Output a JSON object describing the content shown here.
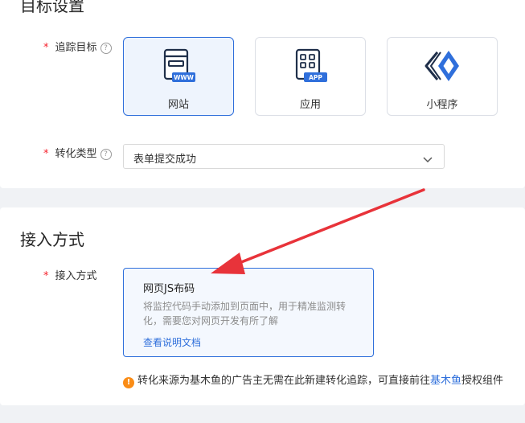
{
  "target_section": {
    "title": "目标设置",
    "track_label": "追踪目标",
    "tiles": [
      {
        "label": "网站",
        "badge": "WWW",
        "icon": "website-icon",
        "selected": true
      },
      {
        "label": "应用",
        "badge": "APP",
        "icon": "app-icon",
        "selected": false
      },
      {
        "label": "小程序",
        "icon": "mini-program-icon",
        "selected": false
      }
    ],
    "conversion_label": "转化类型",
    "conversion_value": "表单提交成功"
  },
  "access_section": {
    "title": "接入方式",
    "label": "接入方式",
    "method": {
      "title": "网页JS布码",
      "description": "将监控代码手动添加到页面中，用于精准监测转化，需要您对网页开发有所了解",
      "link": "查看说明文档"
    },
    "notice_prefix": "转化来源为基木鱼的广告主无需在此新建转化追踪，可直接前往",
    "notice_link": "基木鱼",
    "notice_suffix": "授权组件"
  },
  "colors": {
    "primary": "#2f6fdb",
    "required": "#f5222d",
    "warning": "#fa8c16",
    "arrow": "#e8333a"
  }
}
